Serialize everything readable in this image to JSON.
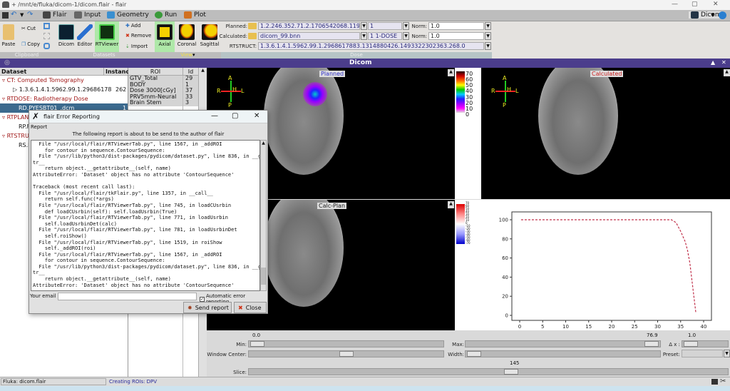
{
  "window": {
    "title": "+ /mnt/e/fluka/dicom-1/dicom.flair - flair",
    "minimize": "—",
    "maximize": "▢",
    "close": "✕"
  },
  "menu": {
    "tabs": [
      "Flair",
      "Input",
      "Geometry",
      "Run",
      "Plot"
    ],
    "right_tab": "Dicom"
  },
  "ribbon": {
    "clipboard": {
      "label": "Clipboard",
      "paste": "Paste",
      "cut": "Cut",
      "copy": "Copy"
    },
    "datasets": {
      "label": "Datasets",
      "dicom": "Dicom",
      "editor": "Editor",
      "rtviewer": "RTViewer",
      "add": "Add",
      "remove": "Remove",
      "import": "Import"
    },
    "view": {
      "label": "View",
      "axial": "Axial",
      "coronal": "Coronal",
      "sagittal": "Sagittal"
    },
    "dose": {
      "label": "Dose",
      "planned_label": "Planned:",
      "planned_value": "1.2.246.352.71.2.1706542068.119664",
      "planned_select": "1",
      "calculated_label": "Calculated:",
      "calculated_value": "dicom_99.bnn",
      "calculated_select": "1 1-DOSE",
      "norm_label": "Norm:",
      "norm1": "1.0",
      "norm2": "1.0",
      "rtstruct_label": "RTSTRUCT:",
      "rtstruct_value": "1.3.6.1.4.1.5962.99.1.2968617883.1314880426.1493322302363.268.0"
    }
  },
  "panel_title": "Dicom",
  "tree": {
    "headers": [
      "Dataset",
      "Instance"
    ],
    "rows": [
      {
        "label": "CT: Computed Tomography",
        "type": "group"
      },
      {
        "label": "1.3.6.1.4.1.5962.99.1.29686178",
        "instance": "262",
        "type": "item"
      },
      {
        "label": "RTDOSE: Radiotherapy Dose",
        "type": "group"
      },
      {
        "label": "RD.PYESBT01_.dcm",
        "instance": "1",
        "type": "selected"
      },
      {
        "label": "RTPLAN",
        "type": "group"
      },
      {
        "label": "RP.F",
        "type": "item"
      },
      {
        "label": "RTSTRU",
        "type": "group"
      },
      {
        "label": "RS.F",
        "type": "item"
      }
    ]
  },
  "roi": {
    "headers": [
      "ROI",
      "Id"
    ],
    "rows": [
      [
        "GTV_Total",
        "29"
      ],
      [
        "BODY",
        "1"
      ],
      [
        "Dose 3000[cGy]",
        "37"
      ],
      [
        "PRV5mm-Neural",
        "33"
      ],
      [
        "Brain Stem",
        "3"
      ]
    ]
  },
  "views": {
    "planned": "Planned",
    "calculated": "Calculated",
    "calc_plan": "Calc-Plan",
    "orient": {
      "a": "A",
      "p": "P",
      "r": "R",
      "l": "L",
      "h": "H"
    }
  },
  "colorbar1": {
    "ticks": [
      "70",
      "60",
      "50",
      "40",
      "30",
      "20",
      "10",
      "0"
    ]
  },
  "colorbar2": {
    "ticks": [
      "70",
      "60",
      "50",
      "40",
      "30",
      "20",
      "10",
      "0",
      "-10",
      "-20",
      "-30",
      "-40",
      "-50",
      "-60",
      "-70"
    ]
  },
  "chart_data": {
    "type": "line",
    "x": [
      0.3,
      33,
      34,
      35,
      36,
      36.5,
      37,
      38.3
    ],
    "y": [
      100,
      100,
      97,
      88,
      77,
      68,
      55,
      3
    ],
    "xlim": [
      0,
      40
    ],
    "ylim": [
      0,
      100
    ],
    "xticks": [
      "0",
      "5",
      "10",
      "15",
      "20",
      "25",
      "30",
      "35",
      "40"
    ],
    "yticks": [
      "0",
      "20",
      "40",
      "60",
      "80",
      "100"
    ],
    "line_color": "#c0304a",
    "line_style": "dashed"
  },
  "controls": {
    "min_label": "Min:",
    "min_value": "0.0",
    "max_label": "Max:",
    "max_value": "76.9",
    "dx_label": "Δ x :",
    "dx_value": "1.0",
    "wc_label": "Window Center:",
    "width_label": "Width:",
    "preset_label": "Preset:",
    "slice_label": "Slice:",
    "slice_value": "145",
    "min_frac": 0.0,
    "max_frac": 1.0,
    "wc_frac": 0.5,
    "width_frac": 0.0,
    "slice_frac": 0.55
  },
  "status": {
    "left": "Fluka: dicom.flair",
    "message": "Creating ROIs: DPV"
  },
  "dialog": {
    "title": "flair Error Reporting",
    "group": "Report",
    "intro": "The following report is about to be send to the author of flair",
    "report": "  File \"/usr/local/flair/RTViewerTab.py\", line 1567, in _addROI\n    for contour in sequence.ContourSequence:\n  File \"/usr/lib/python3/dist-packages/pydicom/dataset.py\", line 836, in __getat\ntr__\n    return object.__getattribute__(self, name)\nAttributeError: 'Dataset' object has no attribute 'ContourSequence'\n\nTraceback (most recent call last):\n  File \"/usr/local/flair/tkFlair.py\", line 1357, in __call__\n    return self.func(*args)\n  File \"/usr/local/flair/RTViewerTab.py\", line 745, in loadCUsrbin\n    def loadCUsrbin(self): self.loadUsrbin(True)\n  File \"/usr/local/flair/RTViewerTab.py\", line 771, in loadUsrbin\n    self.loadUsrbinDet(calc)\n  File \"/usr/local/flair/RTViewerTab.py\", line 781, in loadUsrbinDet\n    self.roiShow()\n  File \"/usr/local/flair/RTViewerTab.py\", line 1519, in roiShow\n    self._addROI(roi)\n  File \"/usr/local/flair/RTViewerTab.py\", line 1567, in _addROI\n    for contour in sequence.ContourSequence:\n  File \"/usr/lib/python3/dist-packages/pydicom/dataset.py\", line 836, in __getat\ntr__\n    return object.__getattribute__(self, name)\nAttributeError: 'Dataset' object has no attribute 'ContourSequence'",
    "email_label": "Your email",
    "email_value": "",
    "auto_label": "Automatic error reporting",
    "auto_checked": true,
    "send": "Send report",
    "close": "Close"
  }
}
